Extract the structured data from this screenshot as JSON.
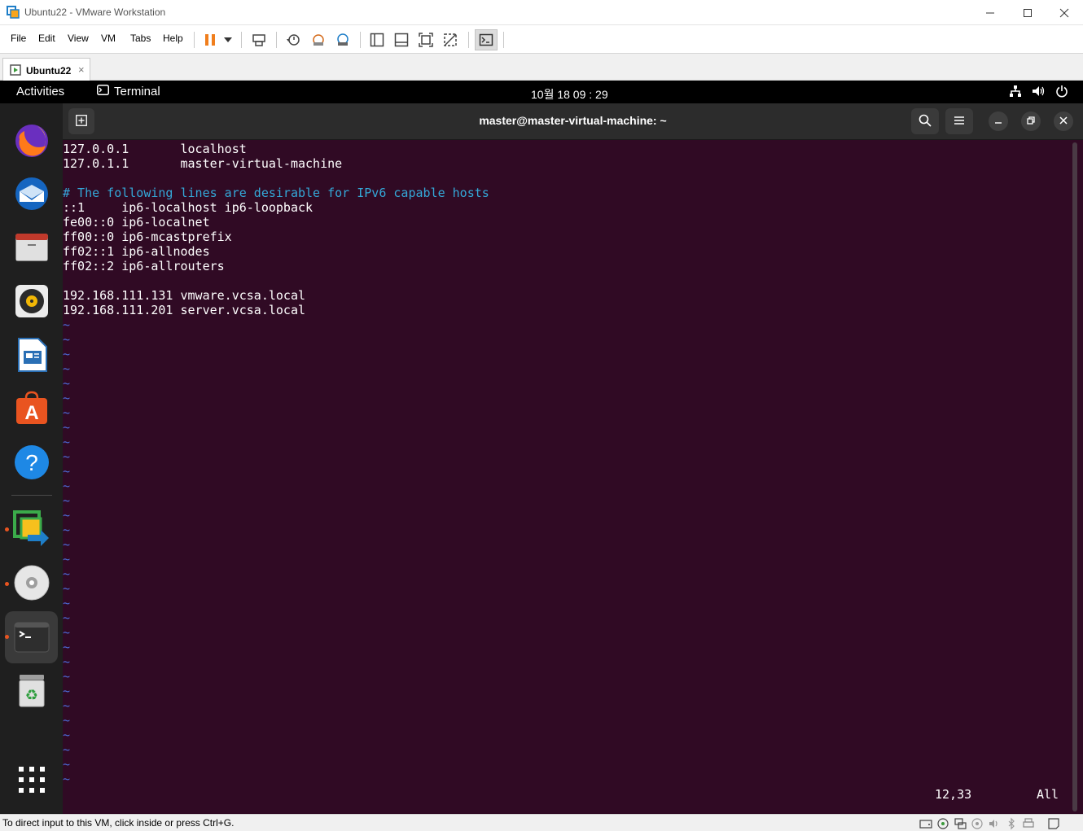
{
  "window": {
    "title": "Ubuntu22 - VMware Workstation"
  },
  "menubar": {
    "items": [
      "File",
      "Edit",
      "View",
      "VM",
      "Tabs",
      "Help"
    ]
  },
  "tabs": [
    {
      "label": "Ubuntu22",
      "close": "×"
    }
  ],
  "ubuntu_topbar": {
    "activities": "Activities",
    "app_name": "Terminal",
    "clock": "10월 18  09 : 29"
  },
  "terminal": {
    "title": "master@master-virtual-machine: ~",
    "lines": [
      {
        "text": "127.0.0.1       localhost",
        "kind": "normal"
      },
      {
        "text": "127.0.1.1       master-virtual-machine",
        "kind": "normal"
      },
      {
        "text": "",
        "kind": "normal"
      },
      {
        "text": "# The following lines are desirable for IPv6 capable hosts",
        "kind": "comment"
      },
      {
        "text": "::1     ip6-localhost ip6-loopback",
        "kind": "normal"
      },
      {
        "text": "fe00::0 ip6-localnet",
        "kind": "normal"
      },
      {
        "text": "ff00::0 ip6-mcastprefix",
        "kind": "normal"
      },
      {
        "text": "ff02::1 ip6-allnodes",
        "kind": "normal"
      },
      {
        "text": "ff02::2 ip6-allrouters",
        "kind": "normal"
      },
      {
        "text": "",
        "kind": "normal"
      },
      {
        "text": "192.168.111.131 vmware.vcsa.local",
        "kind": "normal"
      },
      {
        "text": "192.168.111.201 server.vcsa.local",
        "kind": "normal"
      }
    ],
    "tilde": "~",
    "tilde_count": 32,
    "cursor_position": "12,33",
    "scroll_indicator": "All"
  },
  "statusbar": {
    "hint": "To direct input to this VM, click inside or press Ctrl+G."
  },
  "colors": {
    "terminal_bg": "#300a24",
    "comment": "#34a8d8",
    "tilde": "#4b6bd6",
    "ubuntu_accent": "#e95420",
    "pause_orange": "#f07e1c"
  }
}
